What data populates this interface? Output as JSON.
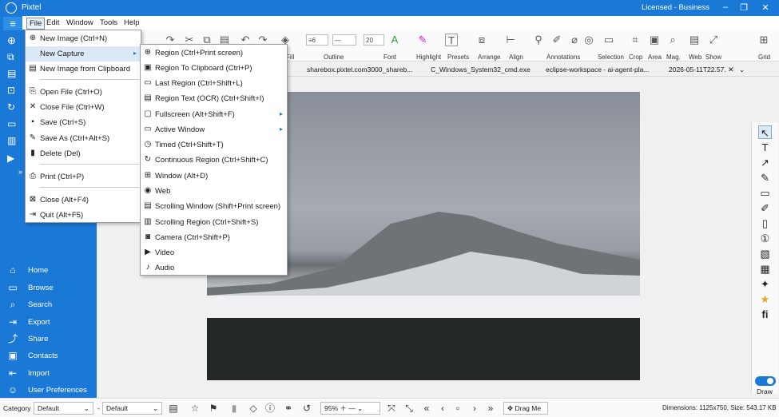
{
  "app": {
    "name": "Pixtel",
    "license": "Licensed - Business"
  },
  "window_controls": [
    "–",
    "❐",
    "✕"
  ],
  "menubar": [
    {
      "label": "File",
      "active": true
    },
    {
      "label": "Edit"
    },
    {
      "label": "Window"
    },
    {
      "label": "Tools"
    },
    {
      "label": "Help"
    }
  ],
  "sidebar": {
    "items": [
      {
        "label": "Home",
        "icon": "home-icon"
      },
      {
        "label": "Browse",
        "icon": "folder-icon"
      },
      {
        "label": "Search",
        "icon": "search-icon"
      },
      {
        "label": "Export",
        "icon": "export-icon"
      },
      {
        "label": "Share",
        "icon": "share-icon"
      },
      {
        "label": "Contacts",
        "icon": "contacts-icon"
      },
      {
        "label": "Import",
        "icon": "import-icon"
      },
      {
        "label": "User Preferences",
        "icon": "user-icon"
      }
    ]
  },
  "ribbon": {
    "fill": "Fill",
    "outline": "Outline",
    "font": "Font",
    "highlight": "Highlight",
    "presets": "Presets",
    "arrange": "Arrange",
    "align": "Align",
    "annotations": "Annotations",
    "selection": "Selection",
    "crop": "Crop",
    "area": "Area",
    "mag": "Mag.",
    "web": "Web",
    "show": "Show",
    "grid": "Grid",
    "line_width": "6",
    "font_size": "20"
  },
  "tabs": [
    "sharebox.pixtel.com3000_shareb...",
    "C_Windows_System32_cmd.exe",
    "eclipse-workspace - ai-agent-pla...",
    "2026-05-11T22.57."
  ],
  "file_menu": {
    "items": [
      {
        "label": "New Image (Ctrl+N)",
        "icon": "plus-circle-icon"
      },
      {
        "label": "New Capture",
        "submenu": true
      },
      {
        "label": "New Image from Clipboard",
        "icon": "clipboard-icon"
      },
      {
        "sep": true
      },
      {
        "label": "Open File (Ctrl+O)",
        "icon": "open-icon"
      },
      {
        "label": "Close File (Ctrl+W)",
        "icon": "close-icon"
      },
      {
        "label": "Save (Ctrl+S)",
        "icon": "save-icon"
      },
      {
        "label": "Save As (Ctrl+Alt+S)",
        "icon": "save-as-icon"
      },
      {
        "label": "Delete (Del)",
        "icon": "trash-icon"
      },
      {
        "sep": true
      },
      {
        "label": "Print (Ctrl+P)",
        "icon": "print-icon"
      },
      {
        "sep": true
      },
      {
        "label": "Close (Alt+F4)",
        "icon": "close-box-icon"
      },
      {
        "label": "Quit (Alt+F5)",
        "icon": "quit-icon"
      }
    ]
  },
  "capture_menu": {
    "items": [
      {
        "label": "Region (Ctrl+Print screen)",
        "icon": "region-icon"
      },
      {
        "label": "Region To Clipboard (Ctrl+P)",
        "icon": "region-clipboard-icon"
      },
      {
        "label": "Last Region (Ctrl+Shift+L)",
        "icon": "last-region-icon"
      },
      {
        "label": "Region Text (OCR) (Ctrl+Shift+I)",
        "icon": "ocr-icon"
      },
      {
        "label": "Fullscreen (Alt+Shift+F)",
        "icon": "fullscreen-icon",
        "submenu": true
      },
      {
        "label": "Active Window",
        "icon": "window-icon",
        "submenu": true
      },
      {
        "label": "Timed (Ctrl+Shift+T)",
        "icon": "timer-icon"
      },
      {
        "label": "Continuous Region (Ctrl+Shift+C)",
        "icon": "continuous-icon"
      },
      {
        "label": "Window (Alt+D)",
        "icon": "windows-logo-icon"
      },
      {
        "label": "Web",
        "icon": "globe-icon"
      },
      {
        "label": "Scrolling Window (Shift+Print screen)",
        "icon": "scroll-window-icon"
      },
      {
        "label": "Scrolling Region (Ctrl+Shift+S)",
        "icon": "scroll-region-icon"
      },
      {
        "label": "Camera (Ctrl+Shift+P)",
        "icon": "camera-icon"
      },
      {
        "label": "Video",
        "icon": "video-icon"
      },
      {
        "label": "Audio",
        "icon": "audio-icon"
      }
    ]
  },
  "right_tools": {
    "draw_label": "Draw"
  },
  "status": {
    "category_label": "Category",
    "category_value": "Default",
    "second_value": "Default",
    "zoom": "95%",
    "drag_me": "Drag Me",
    "dimensions": "Dimensions: 1125x750, Size: 543.17 KB"
  },
  "colors": {
    "accent": "#1a78d7"
  }
}
